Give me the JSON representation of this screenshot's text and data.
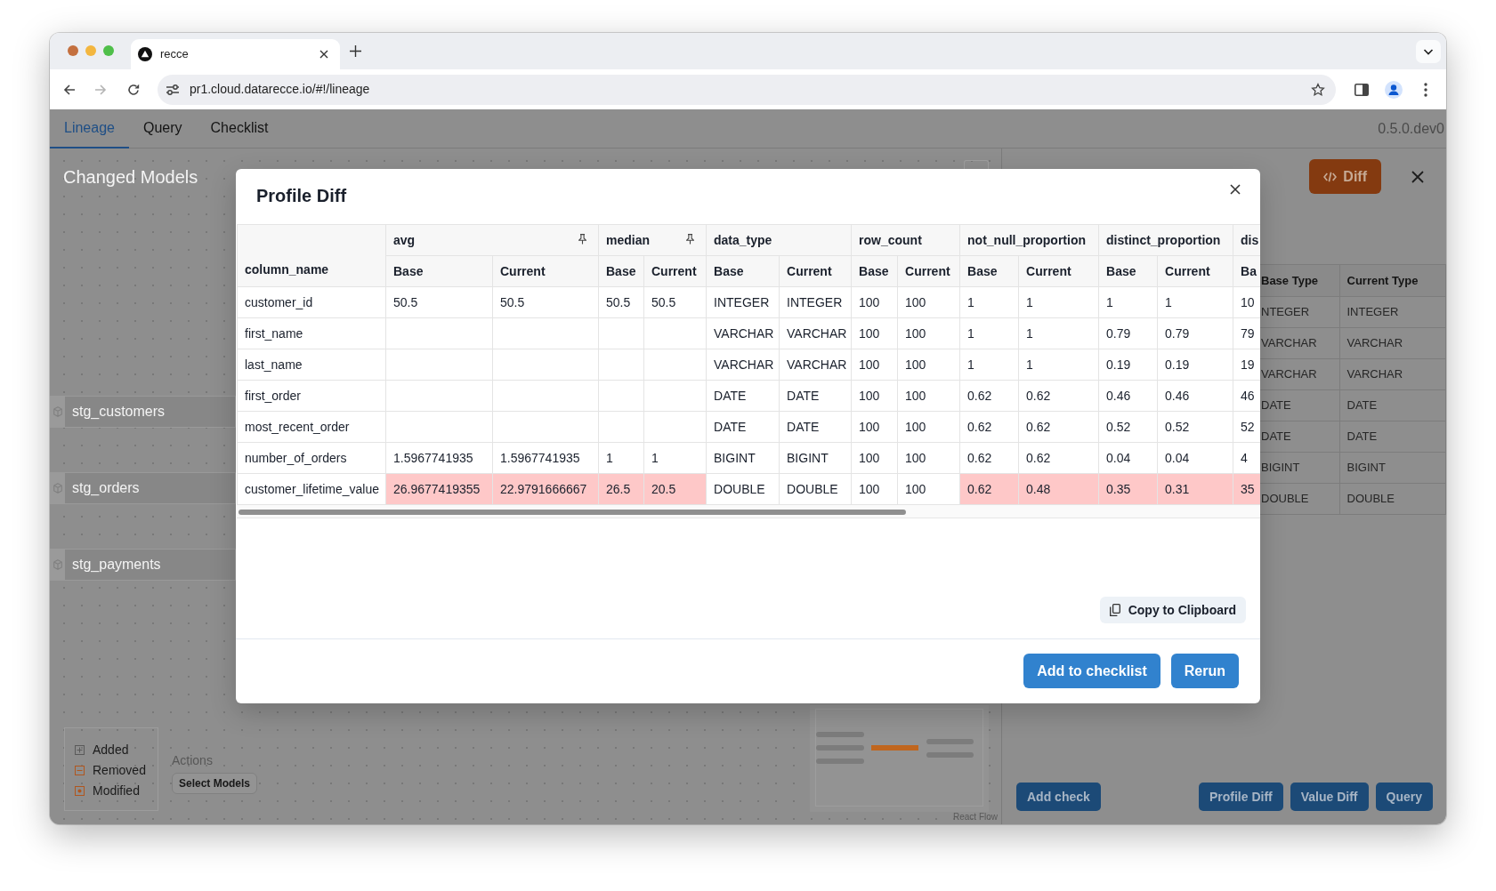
{
  "browser": {
    "tab_title": "recce",
    "url": "pr1.cloud.datarecce.io/#!/lineage"
  },
  "app": {
    "nav": [
      {
        "label": "Lineage",
        "selected": true
      },
      {
        "label": "Query",
        "selected": false
      },
      {
        "label": "Checklist",
        "selected": false
      }
    ],
    "version": "0.5.0.dev0"
  },
  "lineage": {
    "title": "Changed Models",
    "nodes": [
      {
        "label": "stg_customers"
      },
      {
        "label": "stg_orders"
      },
      {
        "label": "stg_payments"
      }
    ],
    "legend": [
      {
        "kind": "added",
        "label": "Added"
      },
      {
        "kind": "removed",
        "label": "Removed"
      },
      {
        "kind": "modified",
        "label": "Modified"
      }
    ],
    "actions": {
      "label": "Actions",
      "button": "Select Models"
    },
    "attribution": "React Flow"
  },
  "side_panel": {
    "diff_button": "Diff",
    "table": {
      "columns": [
        "Base Type",
        "Current Type"
      ],
      "rows": [
        [
          "NTEGER",
          "INTEGER"
        ],
        [
          "VARCHAR",
          "VARCHAR"
        ],
        [
          "VARCHAR",
          "VARCHAR"
        ],
        [
          "DATE",
          "DATE"
        ],
        [
          "DATE",
          "DATE"
        ],
        [
          "BIGINT",
          "BIGINT"
        ],
        [
          "DOUBLE",
          "DOUBLE"
        ]
      ]
    },
    "add_check": "Add check",
    "buttons": [
      "Profile Diff",
      "Value Diff",
      "Query"
    ]
  },
  "modal": {
    "title": "Profile Diff",
    "table": {
      "key_column": "column_name",
      "groups": [
        {
          "name": "avg",
          "pinned": true,
          "subcolumns": [
            "Base",
            "Current"
          ]
        },
        {
          "name": "median",
          "pinned": true,
          "subcolumns": [
            "Base",
            "Current"
          ]
        },
        {
          "name": "data_type",
          "pinned": false,
          "subcolumns": [
            "Base",
            "Current"
          ]
        },
        {
          "name": "row_count",
          "pinned": false,
          "subcolumns": [
            "Base",
            "Current"
          ]
        },
        {
          "name": "not_null_proportion",
          "pinned": false,
          "subcolumns": [
            "Base",
            "Current"
          ]
        },
        {
          "name": "distinct_proportion",
          "pinned": false,
          "subcolumns": [
            "Base",
            "Current"
          ]
        },
        {
          "name": "dis",
          "pinned": false,
          "subcolumns": [
            "Ba"
          ]
        }
      ],
      "rows": [
        {
          "column_name": "customer_id",
          "cells": [
            {
              "values": [
                "50.5",
                "50.5"
              ],
              "changed": false
            },
            {
              "values": [
                "50.5",
                "50.5"
              ],
              "changed": false
            },
            {
              "values": [
                "INTEGER",
                "INTEGER"
              ],
              "changed": false
            },
            {
              "values": [
                "100",
                "100"
              ],
              "changed": false
            },
            {
              "values": [
                "1",
                "1"
              ],
              "changed": false
            },
            {
              "values": [
                "1",
                "1"
              ],
              "changed": false
            },
            {
              "values": [
                "10"
              ],
              "changed": false
            }
          ]
        },
        {
          "column_name": "first_name",
          "cells": [
            null,
            null,
            {
              "values": [
                "VARCHAR",
                "VARCHAR"
              ],
              "changed": false
            },
            {
              "values": [
                "100",
                "100"
              ],
              "changed": false
            },
            {
              "values": [
                "1",
                "1"
              ],
              "changed": false
            },
            {
              "values": [
                "0.79",
                "0.79"
              ],
              "changed": false
            },
            {
              "values": [
                "79"
              ],
              "changed": false
            }
          ]
        },
        {
          "column_name": "last_name",
          "cells": [
            null,
            null,
            {
              "values": [
                "VARCHAR",
                "VARCHAR"
              ],
              "changed": false
            },
            {
              "values": [
                "100",
                "100"
              ],
              "changed": false
            },
            {
              "values": [
                "1",
                "1"
              ],
              "changed": false
            },
            {
              "values": [
                "0.19",
                "0.19"
              ],
              "changed": false
            },
            {
              "values": [
                "19"
              ],
              "changed": false
            }
          ]
        },
        {
          "column_name": "first_order",
          "cells": [
            null,
            null,
            {
              "values": [
                "DATE",
                "DATE"
              ],
              "changed": false
            },
            {
              "values": [
                "100",
                "100"
              ],
              "changed": false
            },
            {
              "values": [
                "0.62",
                "0.62"
              ],
              "changed": false
            },
            {
              "values": [
                "0.46",
                "0.46"
              ],
              "changed": false
            },
            {
              "values": [
                "46"
              ],
              "changed": false
            }
          ]
        },
        {
          "column_name": "most_recent_order",
          "cells": [
            null,
            null,
            {
              "values": [
                "DATE",
                "DATE"
              ],
              "changed": false
            },
            {
              "values": [
                "100",
                "100"
              ],
              "changed": false
            },
            {
              "values": [
                "0.62",
                "0.62"
              ],
              "changed": false
            },
            {
              "values": [
                "0.52",
                "0.52"
              ],
              "changed": false
            },
            {
              "values": [
                "52"
              ],
              "changed": false
            }
          ]
        },
        {
          "column_name": "number_of_orders",
          "cells": [
            {
              "values": [
                "1.5967741935",
                "1.5967741935"
              ],
              "changed": false
            },
            {
              "values": [
                "1",
                "1"
              ],
              "changed": false
            },
            {
              "values": [
                "BIGINT",
                "BIGINT"
              ],
              "changed": false
            },
            {
              "values": [
                "100",
                "100"
              ],
              "changed": false
            },
            {
              "values": [
                "0.62",
                "0.62"
              ],
              "changed": false
            },
            {
              "values": [
                "0.04",
                "0.04"
              ],
              "changed": false
            },
            {
              "values": [
                "4"
              ],
              "changed": false
            }
          ]
        },
        {
          "column_name": "customer_lifetime_value",
          "cells": [
            {
              "values": [
                "26.9677419355",
                "22.9791666667"
              ],
              "changed": true
            },
            {
              "values": [
                "26.5",
                "20.5"
              ],
              "changed": true
            },
            {
              "values": [
                "DOUBLE",
                "DOUBLE"
              ],
              "changed": false
            },
            {
              "values": [
                "100",
                "100"
              ],
              "changed": false
            },
            {
              "values": [
                "0.62",
                "0.48"
              ],
              "changed": true
            },
            {
              "values": [
                "0.35",
                "0.31"
              ],
              "changed": true
            },
            {
              "values": [
                "35"
              ],
              "changed": true
            }
          ]
        }
      ]
    },
    "copy_button": "Copy to Clipboard",
    "buttons": [
      "Add to checklist",
      "Rerun"
    ]
  }
}
